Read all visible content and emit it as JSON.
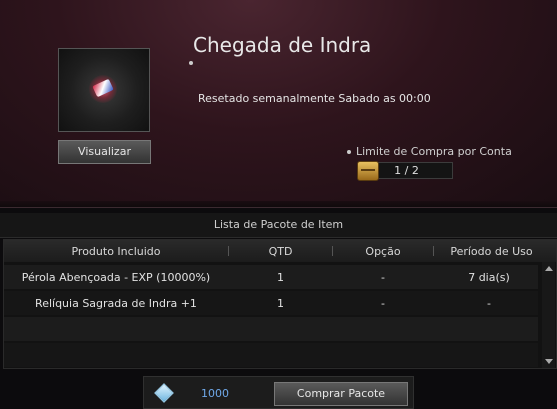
{
  "package": {
    "title": "Chegada de Indra",
    "reset_text": "Resetado semanalmente Sabado as 00:00",
    "view_button": "Visualizar",
    "limit_label": "Limite de Compra por Conta",
    "limit_value": "1 / 2"
  },
  "item_list": {
    "title": "Lista de Pacote de Item",
    "columns": [
      "Produto Incluido",
      "QTD",
      "Opção",
      "Período de Uso"
    ],
    "rows": [
      {
        "product": "Pérola Abençoada - EXP (10000%)",
        "qty": "1",
        "option": "-",
        "period": "7 dia(s)"
      },
      {
        "product": "Relíquia Sagrada de Indra +1",
        "qty": "1",
        "option": "-",
        "period": "-"
      }
    ]
  },
  "footer": {
    "price": "1000",
    "buy_button": "Comprar Pacote"
  },
  "icons": {
    "thumbnail": "package-thumbnail-icon",
    "limit": "treasure-chest-icon",
    "currency": "diamond-gem-icon"
  },
  "colors": {
    "price": "#6fa8e8",
    "panel_accent": "#2e141c"
  }
}
